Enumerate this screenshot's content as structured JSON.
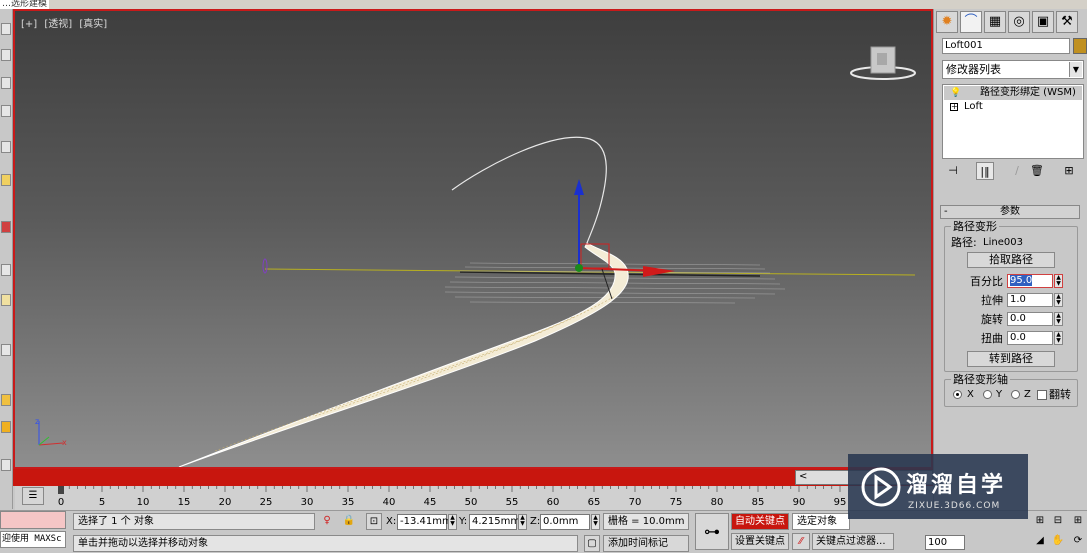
{
  "window": {
    "title": "…选形建模"
  },
  "viewport": {
    "labels": [
      "[+]",
      "[透视]",
      "[真实]"
    ],
    "border_color": "#c81a1a"
  },
  "timeline": {
    "slider_label": "<",
    "ruler_ticks": [
      "0",
      "5",
      "10",
      "15",
      "20",
      "25",
      "30",
      "35",
      "40",
      "45",
      "50",
      "55",
      "60",
      "65",
      "70",
      "75",
      "80",
      "85",
      "90",
      "95"
    ]
  },
  "status": {
    "selection": "选择了 1 个 对象",
    "prompt": "单击并拖动以选择并移动对象",
    "maxscript": "迎使用 MAXSc",
    "x_label": "X:",
    "x_value": "-13.41mm",
    "y_label": "Y:",
    "y_value": "4.215mm",
    "z_label": "Z:",
    "z_value": "0.0mm",
    "grid": "栅格 = 10.0mm",
    "add_time_tag": "添加时间标记",
    "auto_key": "自动关键点",
    "set_key": "设置关键点",
    "selected_object": "选定对象",
    "key_filters": "关键点过滤器...",
    "frame_value": "100"
  },
  "cmdpanel": {
    "tabs": [
      "create-icon",
      "modify-icon",
      "hierarchy-icon",
      "motion-icon",
      "display-icon",
      "utilities-icon"
    ],
    "object_name": "Loft001",
    "object_color": "#c09020",
    "modifier_list": "修改器列表",
    "stack": [
      "路径变形绑定 (WSM)",
      "Loft"
    ],
    "rollout_title": "参数",
    "group_path_deform": "路径变形",
    "path_label": "路径:",
    "path_value": "Line003",
    "pick_path": "拾取路径",
    "percent_label": "百分比",
    "percent_value": "95.0",
    "stretch_label": "拉伸",
    "stretch_value": "1.0",
    "rotate_label": "旋转",
    "rotate_value": "0.0",
    "twist_label": "扭曲",
    "twist_value": "0.0",
    "move_to_path": "转到路径",
    "group_axis": "路径变形轴",
    "axis_x": "X",
    "axis_y": "Y",
    "axis_z": "Z",
    "axis_selected": "X",
    "flip": "翻转"
  },
  "watermark": {
    "title": "溜溜自学",
    "subtitle": "ZIXUE.3D66.COM"
  }
}
